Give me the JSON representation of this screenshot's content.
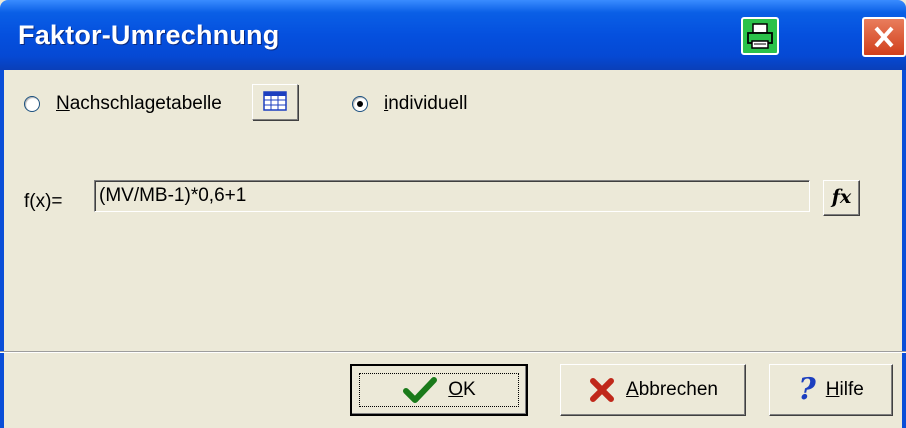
{
  "window": {
    "title": "Faktor-Umrechnung"
  },
  "titlebar_buttons": {
    "print_icon": "printer-icon",
    "close_icon": "close-icon"
  },
  "options": {
    "lookup": {
      "prefix": "",
      "underlined": "N",
      "rest": "achschlagetabelle",
      "selected": false,
      "button_icon": "table-icon"
    },
    "individual": {
      "underlined": "i",
      "rest": "ndividuell",
      "selected": true
    }
  },
  "formula": {
    "label": "f(x)=",
    "value": "(MV/MB-1)*0,6+1",
    "fx_button_label": "fx"
  },
  "buttons": {
    "ok": {
      "underlined": "O",
      "rest": "K",
      "icon": "checkmark-icon"
    },
    "cancel": {
      "underlined": "A",
      "rest": "bbrechen",
      "icon": "x-icon"
    },
    "help": {
      "underlined": "H",
      "rest": "ilfe",
      "icon": "question-icon"
    }
  },
  "colors": {
    "titlebar": "#0550de",
    "face": "#ece9d8",
    "ok_check": "#1a7a1a",
    "cancel_x": "#c0281a",
    "help": "#1c3fbf"
  }
}
